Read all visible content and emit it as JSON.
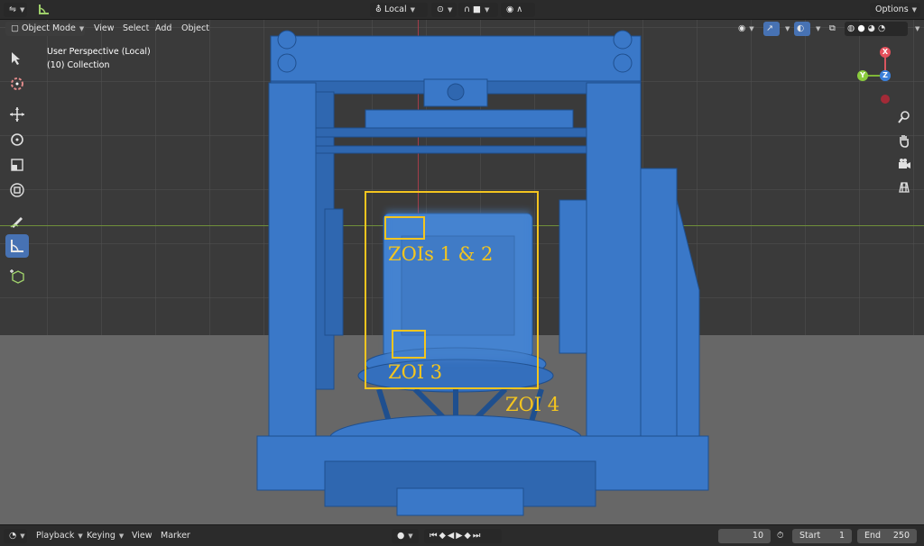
{
  "header": {
    "mode_label": "Object Mode",
    "menus": [
      "View",
      "Select",
      "Add",
      "Object"
    ],
    "transform_orientation": "Local",
    "options_label": "Options"
  },
  "viewport": {
    "view_name": "User Perspective (Local)",
    "collection": "(10) Collection",
    "gizmo": {
      "x_label": "X",
      "y_label": "Y",
      "z_label": "Z"
    }
  },
  "annotations": {
    "zoi_1_2": "ZOIs 1 & 2",
    "zoi_3": "ZOI 3",
    "zoi_4": "ZOI 4"
  },
  "timeline": {
    "playback": "Playback",
    "keying": "Keying",
    "view": "View",
    "marker": "Marker",
    "current_frame": "10",
    "start_label": "Start",
    "start_value": "1",
    "end_label": "End",
    "end_value": "250"
  },
  "colors": {
    "model_blue": "#3a78c8",
    "zoi_yellow": "#f4c51f",
    "accent": "#4772b3"
  }
}
